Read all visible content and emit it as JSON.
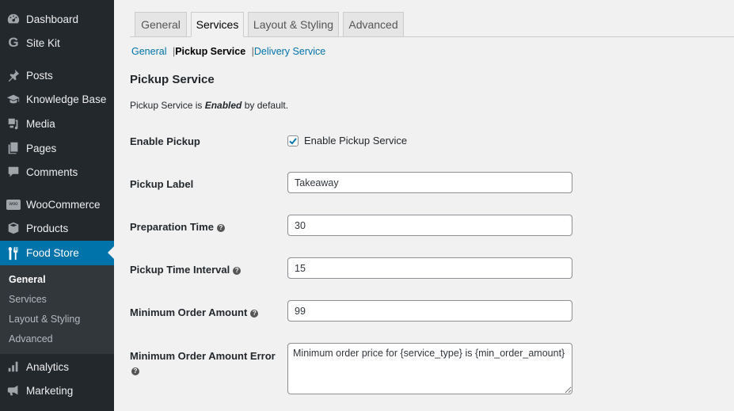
{
  "sidebar": {
    "items": [
      {
        "label": "Dashboard",
        "icon": "dashboard-icon"
      },
      {
        "label": "Site Kit",
        "icon": "google-g-icon"
      },
      {
        "label": "Posts",
        "icon": "pin-icon"
      },
      {
        "label": "Knowledge Base",
        "icon": "graduation-cap-icon"
      },
      {
        "label": "Media",
        "icon": "media-icon"
      },
      {
        "label": "Pages",
        "icon": "pages-icon"
      },
      {
        "label": "Comments",
        "icon": "comment-icon"
      },
      {
        "label": "WooCommerce",
        "icon": "woo-icon"
      },
      {
        "label": "Products",
        "icon": "box-icon"
      },
      {
        "label": "Food Store",
        "icon": "fork-knife-icon",
        "active": true
      },
      {
        "label": "Analytics",
        "icon": "bar-chart-icon"
      },
      {
        "label": "Marketing",
        "icon": "megaphone-icon"
      }
    ],
    "submenu": [
      "General",
      "Services",
      "Layout & Styling",
      "Advanced"
    ],
    "submenu_current": "General"
  },
  "tabs": [
    "General",
    "Services",
    "Layout & Styling",
    "Advanced"
  ],
  "active_tab": "Services",
  "subnav": {
    "general": "General",
    "pickup": "Pickup Service",
    "delivery": "Delivery Service",
    "sep": "|"
  },
  "section": {
    "title": "Pickup Service",
    "desc_prefix": "Pickup Service is ",
    "desc_em": "Enabled",
    "desc_suffix": " by default."
  },
  "fields": {
    "enable_pickup": {
      "label": "Enable Pickup",
      "checkbox_label": "Enable Pickup Service",
      "checked": true
    },
    "pickup_label": {
      "label": "Pickup Label",
      "value": "Takeaway"
    },
    "prep_time": {
      "label": "Preparation Time",
      "value": "30"
    },
    "time_interval": {
      "label": "Pickup Time Interval",
      "value": "15"
    },
    "min_order": {
      "label": "Minimum Order Amount",
      "value": "99"
    },
    "min_order_error": {
      "label": "Minimum Order Amount Error",
      "value": "Minimum order price for {service_type} is {min_order_amount}"
    }
  },
  "help_glyph": "?",
  "colors": {
    "accent": "#0073aa",
    "sidebar_bg": "#23282d",
    "submenu_bg": "#32373c"
  }
}
